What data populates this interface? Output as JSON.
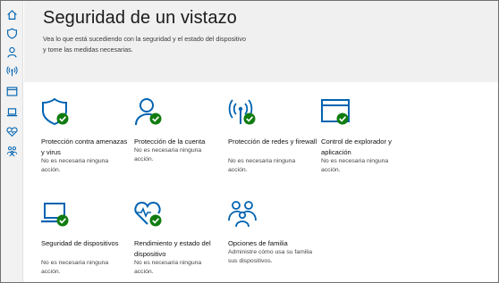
{
  "window": {
    "title": "Seguridad de un vistazo"
  },
  "sidebar": {
    "items": [
      {
        "name": "home",
        "icon": "home-icon"
      },
      {
        "name": "virus",
        "icon": "shield-icon"
      },
      {
        "name": "account",
        "icon": "person-icon"
      },
      {
        "name": "firewall",
        "icon": "wifi-antenna-icon"
      },
      {
        "name": "browser",
        "icon": "browser-window-icon"
      },
      {
        "name": "device-security",
        "icon": "laptop-icon"
      },
      {
        "name": "device-health",
        "icon": "heart-icon"
      },
      {
        "name": "family",
        "icon": "family-icon"
      }
    ]
  },
  "header": {
    "title": "Seguridad de un vistazo",
    "subtitle": "Vea lo que está sucediendo con la seguridad y el estado del dispositivo y tome las medidas necesarias."
  },
  "tiles": [
    {
      "id": "virus",
      "icon": "shield-check-icon",
      "title": "Protección contra amenazas y virus",
      "status": "No es necesaria ninguna acción."
    },
    {
      "id": "account",
      "icon": "person-check-icon",
      "title": "Protección de la cuenta",
      "status": "No es necesaria ninguna acción."
    },
    {
      "id": "firewall",
      "icon": "antenna-check-icon",
      "title": "Protección de redes y firewall",
      "status": "No es necesaria ninguna acción."
    },
    {
      "id": "browser",
      "icon": "browser-check-icon",
      "title": "Control de explorador y aplicación",
      "status": "No es necesaria ninguna acción."
    },
    {
      "id": "device-security",
      "icon": "laptop-check-icon",
      "title": "Seguridad de dispositivos",
      "status": "No es necesaria ninguna acción."
    },
    {
      "id": "device-health",
      "icon": "heart-check-icon",
      "title": "Rendimiento y estado del dispositivo",
      "status": "No es necesaria ninguna acción."
    },
    {
      "id": "family",
      "icon": "family-icon",
      "title": "Opciones de familia",
      "status": "Administre cómo usa su familia sus dispositivos."
    }
  ],
  "colors": {
    "accent": "#0063b1",
    "ok": "#107c10",
    "header_bg": "#f0f0f0",
    "sidebar_bg": "#f2f2f2"
  }
}
